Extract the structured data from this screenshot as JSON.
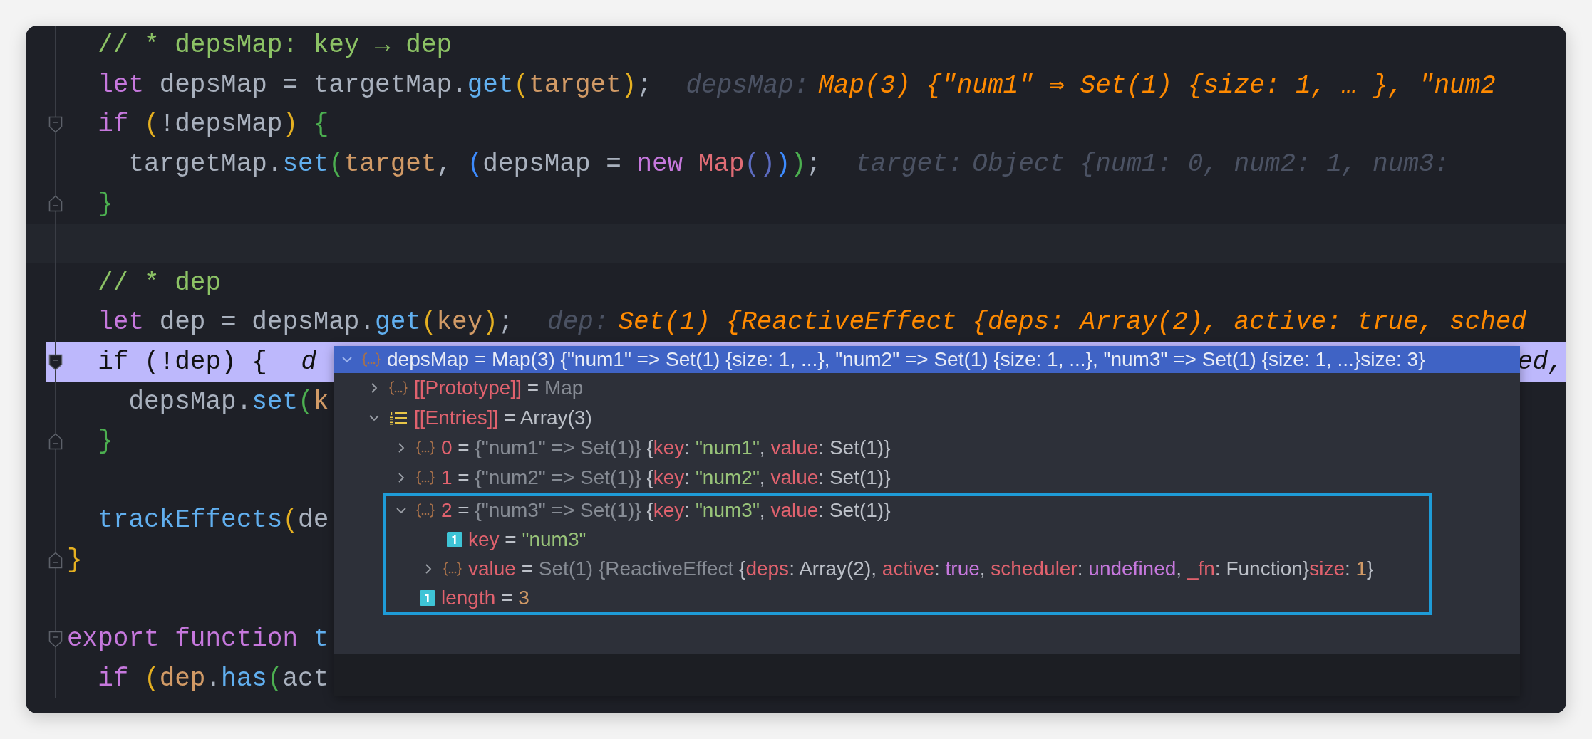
{
  "editor": {
    "lines": [
      {
        "tokens": [
          {
            "kind": "comment",
            "t": "  // * depsMap: key → dep"
          }
        ]
      },
      {
        "tokens": [
          {
            "kind": "keyword",
            "t": "  let "
          },
          {
            "kind": "identifier",
            "t": "depsMap = targetMap."
          },
          {
            "kind": "method",
            "t": "get"
          },
          {
            "kind": "paren",
            "t": "("
          },
          {
            "kind": "param",
            "t": "target"
          },
          {
            "kind": "paren",
            "t": ")"
          },
          {
            "kind": "identifier",
            "t": ";"
          }
        ],
        "hint": {
          "label": "depsMap:",
          "value": "Map(3) {\"num1\" ⇒ Set(1) {size: 1, … }, \"num2",
          "kind": "value"
        }
      },
      {
        "fold": {
          "kind": "start"
        },
        "tokens": [
          {
            "kind": "keyword",
            "t": "  if "
          },
          {
            "kind": "paren",
            "t": "("
          },
          {
            "kind": "identifier",
            "t": "!depsMap"
          },
          {
            "kind": "paren",
            "t": ")"
          },
          {
            "kind": "brace",
            "t": " {"
          }
        ]
      },
      {
        "tokens": [
          {
            "kind": "identifier",
            "t": "    targetMap."
          },
          {
            "kind": "method",
            "t": "set"
          },
          {
            "kind": "brace",
            "t": "("
          },
          {
            "kind": "param",
            "t": "target"
          },
          {
            "kind": "identifier",
            "t": ", "
          },
          {
            "kind": "blueparen",
            "t": "("
          },
          {
            "kind": "identifier",
            "t": "depsMap = "
          },
          {
            "kind": "keyword",
            "t": "new "
          },
          {
            "kind": "class",
            "t": "Map"
          },
          {
            "kind": "indigoparen",
            "t": "()"
          },
          {
            "kind": "blueparen",
            "t": ")"
          },
          {
            "kind": "brace",
            "t": ")"
          },
          {
            "kind": "identifier",
            "t": ";"
          }
        ],
        "hint": {
          "label": "target:",
          "value": "Object {num1: 0, num2: 1, num3:",
          "kind": "dim"
        }
      },
      {
        "fold": {
          "kind": "end"
        },
        "tokens": [
          {
            "kind": "brace",
            "t": "  }"
          }
        ]
      },
      {
        "kind": "caret"
      },
      {
        "tokens": [
          {
            "kind": "comment",
            "t": "  // * dep"
          }
        ]
      },
      {
        "tokens": [
          {
            "kind": "keyword",
            "t": "  let "
          },
          {
            "kind": "identifier",
            "t": "dep = depsMap."
          },
          {
            "kind": "method",
            "t": "get"
          },
          {
            "kind": "paren",
            "t": "("
          },
          {
            "kind": "param",
            "t": "key"
          },
          {
            "kind": "paren",
            "t": ")"
          },
          {
            "kind": "identifier",
            "t": ";"
          }
        ],
        "hint": {
          "label": "dep:",
          "value": "Set(1) {ReactiveEffect {deps: Array(2), active: true, sched",
          "kind": "value"
        }
      },
      {
        "fold": {
          "kind": "start"
        },
        "kind": "execution",
        "tokens": [
          {
            "kind": "identifier",
            "t": "  if (!dep) {"
          }
        ],
        "hint": {
          "label": "d"
        },
        "tail": "ed,"
      },
      {
        "tokens": [
          {
            "kind": "identifier",
            "t": "    depsMap."
          },
          {
            "kind": "method",
            "t": "set"
          },
          {
            "kind": "brace",
            "t": "("
          },
          {
            "kind": "param",
            "t": "k"
          }
        ]
      },
      {
        "fold": {
          "kind": "end"
        },
        "tokens": [
          {
            "kind": "brace",
            "t": "  }"
          }
        ]
      },
      {
        "kind": "blank"
      },
      {
        "tokens": [
          {
            "kind": "method",
            "t": "  trackEffects"
          },
          {
            "kind": "paren",
            "t": "("
          },
          {
            "kind": "identifier",
            "t": "de"
          }
        ]
      },
      {
        "fold": {
          "kind": "end"
        },
        "tokens": [
          {
            "kind": "paren",
            "t": "}"
          }
        ]
      },
      {
        "kind": "blank"
      },
      {
        "fold": {
          "kind": "start"
        },
        "tokens": [
          {
            "kind": "keyword",
            "t": "export function "
          },
          {
            "kind": "method",
            "t": "t"
          }
        ]
      },
      {
        "tokens": [
          {
            "kind": "keyword",
            "t": "  if "
          },
          {
            "kind": "paren",
            "t": "("
          },
          {
            "kind": "param",
            "t": "dep"
          },
          {
            "kind": "identifier",
            "t": "."
          },
          {
            "kind": "method",
            "t": "has"
          },
          {
            "kind": "brace",
            "t": "("
          },
          {
            "kind": "identifier",
            "t": "act"
          }
        ]
      }
    ]
  },
  "debug_popup": {
    "root": {
      "name": "depsMap",
      "kind": "object",
      "expanded": true,
      "selected": true,
      "value": [
        {
          "kind": "plain",
          "t": " = Map(3) {\"num1\" => Set(1) {size: 1, ...}, \"num2\" => Set(1) {size: 1, ...}, \"num3\" => Set(1) {size: 1, ...}size: 3}"
        }
      ],
      "children": [
        {
          "name": "[[Prototype]]",
          "kind": "object",
          "expanded": false,
          "selected": false,
          "value": [
            {
              "kind": "plain",
              "t": " = "
            },
            {
              "kind": "dim",
              "t": "Map"
            }
          ]
        },
        {
          "name": "[[Entries]]",
          "kind": "list",
          "expanded": true,
          "selected": false,
          "value": [
            {
              "kind": "plain",
              "t": " = Array(3)"
            }
          ],
          "children": [
            {
              "name": "0",
              "kind": "object",
              "expanded": false,
              "selected": false,
              "value": [
                {
                  "kind": "plain",
                  "t": " = "
                },
                {
                  "kind": "dim",
                  "t": "{\"num1\" => Set(1)}"
                },
                {
                  "kind": "plain",
                  "t": " {"
                },
                {
                  "kind": "key",
                  "t": "key"
                },
                {
                  "kind": "plain",
                  "t": ": "
                },
                {
                  "kind": "string",
                  "t": "\"num1\""
                },
                {
                  "kind": "plain",
                  "t": ", "
                },
                {
                  "kind": "key",
                  "t": "value"
                },
                {
                  "kind": "plain",
                  "t": ": Set(1)}"
                }
              ]
            },
            {
              "name": "1",
              "kind": "object",
              "expanded": false,
              "selected": false,
              "value": [
                {
                  "kind": "plain",
                  "t": " = "
                },
                {
                  "kind": "dim",
                  "t": "{\"num2\" => Set(1)}"
                },
                {
                  "kind": "plain",
                  "t": " {"
                },
                {
                  "kind": "key",
                  "t": "key"
                },
                {
                  "kind": "plain",
                  "t": ": "
                },
                {
                  "kind": "string",
                  "t": "\"num2\""
                },
                {
                  "kind": "plain",
                  "t": ", "
                },
                {
                  "kind": "key",
                  "t": "value"
                },
                {
                  "kind": "plain",
                  "t": ": Set(1)}"
                }
              ]
            },
            {
              "name": "2",
              "kind": "object",
              "expanded": true,
              "selected": false,
              "framed": true,
              "value": [
                {
                  "kind": "plain",
                  "t": " = "
                },
                {
                  "kind": "dim",
                  "t": "{\"num3\" => Set(1)}"
                },
                {
                  "kind": "plain",
                  "t": " {"
                },
                {
                  "kind": "key",
                  "t": "key"
                },
                {
                  "kind": "plain",
                  "t": ": "
                },
                {
                  "kind": "string",
                  "t": "\"num3\""
                },
                {
                  "kind": "plain",
                  "t": ", "
                },
                {
                  "kind": "key",
                  "t": "value"
                },
                {
                  "kind": "plain",
                  "t": ": Set(1)}"
                }
              ],
              "children": [
                {
                  "name": "key",
                  "kind": "primitive",
                  "selected": false,
                  "value": [
                    {
                      "kind": "plain",
                      "t": " = "
                    },
                    {
                      "kind": "string",
                      "t": "\"num3\""
                    }
                  ]
                },
                {
                  "name": "value",
                  "kind": "object",
                  "expanded": false,
                  "selected": false,
                  "value": [
                    {
                      "kind": "plain",
                      "t": " = "
                    },
                    {
                      "kind": "dim",
                      "t": "Set(1) {ReactiveEffect "
                    },
                    {
                      "kind": "plain",
                      "t": "{"
                    },
                    {
                      "kind": "key",
                      "t": "deps"
                    },
                    {
                      "kind": "plain",
                      "t": ": Array(2), "
                    },
                    {
                      "kind": "key",
                      "t": "active"
                    },
                    {
                      "kind": "plain",
                      "t": ": "
                    },
                    {
                      "kind": "literal",
                      "t": "true"
                    },
                    {
                      "kind": "plain",
                      "t": ", "
                    },
                    {
                      "kind": "key",
                      "t": "scheduler"
                    },
                    {
                      "kind": "plain",
                      "t": ": "
                    },
                    {
                      "kind": "literal",
                      "t": "undefined"
                    },
                    {
                      "kind": "plain",
                      "t": ", "
                    },
                    {
                      "kind": "key",
                      "t": "_fn"
                    },
                    {
                      "kind": "plain",
                      "t": ": Function}"
                    },
                    {
                      "kind": "key",
                      "t": "size"
                    },
                    {
                      "kind": "plain",
                      "t": ": "
                    },
                    {
                      "kind": "number",
                      "t": "1"
                    },
                    {
                      "kind": "plain",
                      "t": "}"
                    }
                  ]
                }
              ]
            },
            {
              "name": "length",
              "kind": "primitive",
              "selected": false,
              "framed": true,
              "value": [
                {
                  "kind": "plain",
                  "t": " = "
                },
                {
                  "kind": "number",
                  "t": "3"
                }
              ]
            }
          ]
        }
      ]
    }
  }
}
